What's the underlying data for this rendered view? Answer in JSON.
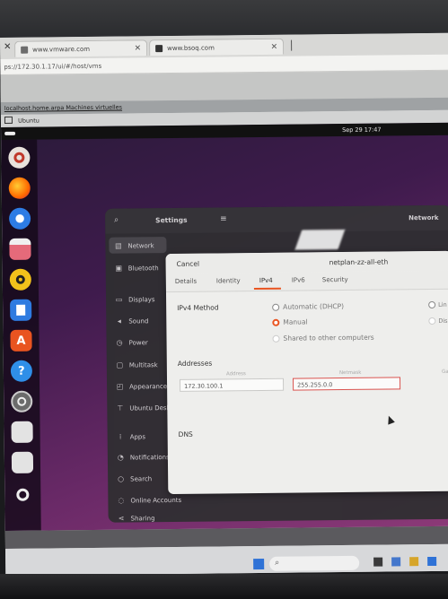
{
  "browser": {
    "tabs": [
      {
        "label": "www.vmware.com"
      },
      {
        "label": "www.bsoq.com"
      }
    ],
    "address": "ps://172.30.1.17/ui/#/host/vms"
  },
  "vm": {
    "breadcrumb": "localhost.home.arpa   Machines virtuelles",
    "title": "Ubuntu"
  },
  "ubuntu": {
    "clock": "Sep 29  17:47"
  },
  "settings": {
    "title": "Settings",
    "network_title": "Network",
    "sidebar": [
      {
        "label": "Network",
        "icon": "network-icon"
      },
      {
        "label": "Bluetooth",
        "icon": "bluetooth-icon"
      },
      {
        "label": "Displays",
        "icon": "display-icon"
      },
      {
        "label": "Sound",
        "icon": "sound-icon"
      },
      {
        "label": "Power",
        "icon": "power-icon"
      },
      {
        "label": "Multitask",
        "icon": "multitask-icon"
      },
      {
        "label": "Appearance",
        "icon": "appearance-icon"
      },
      {
        "label": "Ubuntu Desktop",
        "icon": "ubuntu-desktop-icon"
      },
      {
        "label": "Apps",
        "icon": "apps-icon"
      },
      {
        "label": "Notifications",
        "icon": "bell-icon"
      },
      {
        "label": "Search",
        "icon": "search-icon"
      },
      {
        "label": "Online Accounts",
        "icon": "online-accounts-icon"
      },
      {
        "label": "Sharing",
        "icon": "sharing-icon"
      }
    ]
  },
  "dialog": {
    "cancel_label": "Cancel",
    "title": "netplan-zz-all-eth",
    "tabs": [
      "Details",
      "Identity",
      "IPv4",
      "IPv6",
      "Security"
    ],
    "active_tab": "IPv4",
    "ipv4_method_label": "IPv4 Method",
    "methods": [
      {
        "label": "Automatic (DHCP)",
        "selected": false
      },
      {
        "label": "Manual",
        "selected": true
      },
      {
        "label": "Shared to other computers",
        "selected": false
      }
    ],
    "right_methods": [
      "Lin",
      "Dis"
    ],
    "addresses_label": "Addresses",
    "col_address": "Address",
    "col_netmask": "Netmask",
    "col_gateway": "Ga",
    "address_value": "172.30.100.1",
    "netmask_value": "255.255.0.0",
    "dns_label": "DNS"
  }
}
